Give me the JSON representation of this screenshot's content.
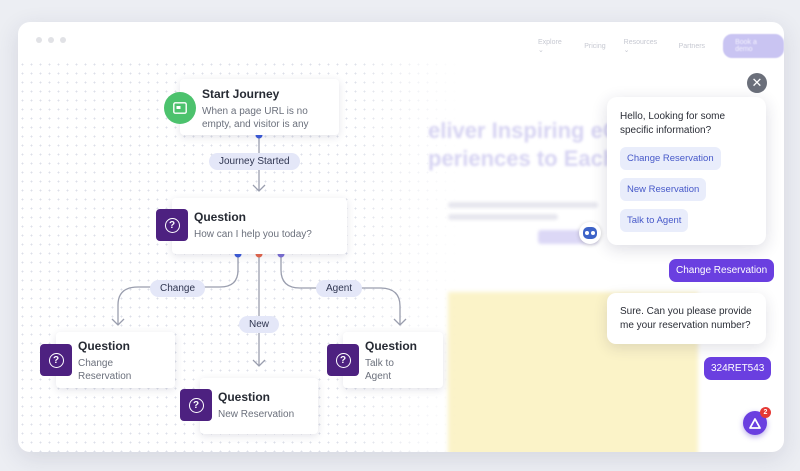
{
  "nodes": {
    "start": {
      "title": "Start Journey",
      "desc_line1": "When a page URL is no",
      "desc_line2": "empty, and visitor is any"
    },
    "q_main": {
      "title": "Question",
      "desc": "How can I help you today?"
    },
    "q_change": {
      "title": "Question",
      "desc_line1": "Change",
      "desc_line2": "Reservation"
    },
    "q_new": {
      "title": "Question",
      "desc": "New Reservation"
    },
    "q_agent": {
      "title": "Question",
      "desc_line1": "Talk to",
      "desc_line2": "Agent"
    }
  },
  "edge_labels": {
    "journey_started": "Journey Started",
    "change": "Change",
    "new": "New",
    "agent": "Agent"
  },
  "website": {
    "nav": [
      "Explore ⌄",
      "Pricing",
      "Resources ⌄",
      "Partners"
    ],
    "cta": "Book a demo",
    "hero_line1": "eliver Inspiring eC",
    "hero_line2": "periences to Each"
  },
  "chat": {
    "greeting": "Hello, Looking for some specific information?",
    "options": [
      "Change Reservation",
      "New Reservation",
      "Talk to Agent"
    ],
    "user_reply_1": "Change Reservation",
    "bot_reply": "Sure. Can you please provide me your reservation number?",
    "user_reply_2": "324RET543",
    "close_glyph": "✕",
    "unread_count": "2"
  },
  "colors": {
    "accent_purple": "#6a3fe0",
    "question_icon": "#4d2180",
    "start_icon": "#4cc26d",
    "dot_blue": "#3b5bdb",
    "dot_orange": "#e8664a",
    "dot_violet": "#7b6fd6"
  }
}
